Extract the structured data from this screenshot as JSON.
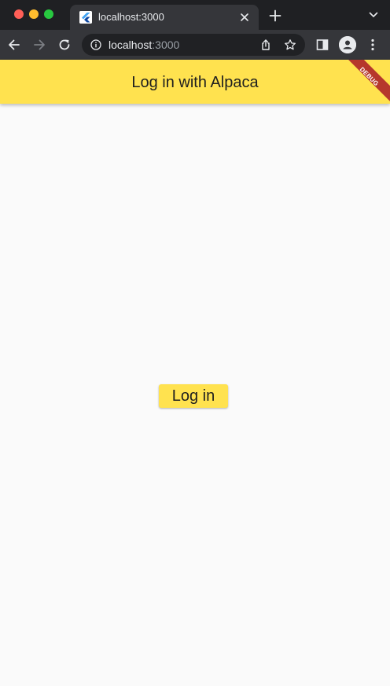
{
  "browser": {
    "tab": {
      "title": "localhost:3000",
      "favicon": "flutter-icon"
    },
    "address_bar": {
      "host": "localhost",
      "port": ":3000"
    },
    "icons": {
      "close_tab": "close-icon",
      "new_tab": "plus-icon",
      "tab_list": "chevron-down-icon",
      "back": "arrow-left-icon",
      "forward": "arrow-right-icon",
      "reload": "reload-icon",
      "site_info": "info-icon",
      "share": "share-icon",
      "bookmark": "star-icon",
      "side_panel": "side-panel-icon",
      "profile": "person-icon",
      "menu": "kebab-menu-icon"
    }
  },
  "app": {
    "app_bar": {
      "title": "Log in with Alpaca",
      "background": "#ffe24f"
    },
    "debug_banner": "DEBUG",
    "login_button": {
      "label": "Log in",
      "background": "#ffe24f"
    },
    "page_background": "#fafafa"
  }
}
